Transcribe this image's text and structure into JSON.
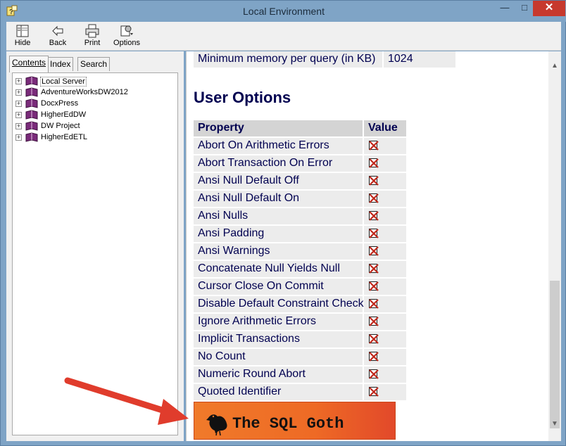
{
  "window": {
    "title": "Local Environment"
  },
  "toolbar": {
    "hide_label": "Hide",
    "back_label": "Back",
    "print_label": "Print",
    "options_label": "Options"
  },
  "tabs": {
    "contents": "Contents",
    "index": "Index",
    "search": "Search"
  },
  "tree": {
    "items": [
      {
        "label": "Local Server",
        "selected": true
      },
      {
        "label": "AdventureWorksDW2012"
      },
      {
        "label": "DocxPress"
      },
      {
        "label": "HigherEdDW"
      },
      {
        "label": "DW Project"
      },
      {
        "label": "HigherEdETL"
      }
    ]
  },
  "content": {
    "partial_row_top": "Minimum memory per query (in KB)",
    "partial_row_top_value": "1024",
    "section_title": "User Options",
    "table_headers": {
      "property": "Property",
      "value": "Value"
    },
    "properties": [
      "Abort On Arithmetic Errors",
      "Abort Transaction On Error",
      "Ansi Null Default Off",
      "Ansi Null Default On",
      "Ansi Nulls",
      "Ansi Padding",
      "Ansi Warnings",
      "Concatenate Null Yields Null",
      "Cursor Close On Commit",
      "Disable Default Constraint Check",
      "Ignore Arithmetic Errors",
      "Implicit Transactions",
      "No Count",
      "Numeric Round Abort",
      "Quoted Identifier"
    ],
    "value_icon": "unchecked-box-icon"
  },
  "watermark": {
    "text": "The SQL Goth"
  },
  "colors": {
    "heading": "#000050",
    "accent": "#c7392d",
    "arrow": "#e03c2c",
    "banner": "#ee6a25"
  }
}
